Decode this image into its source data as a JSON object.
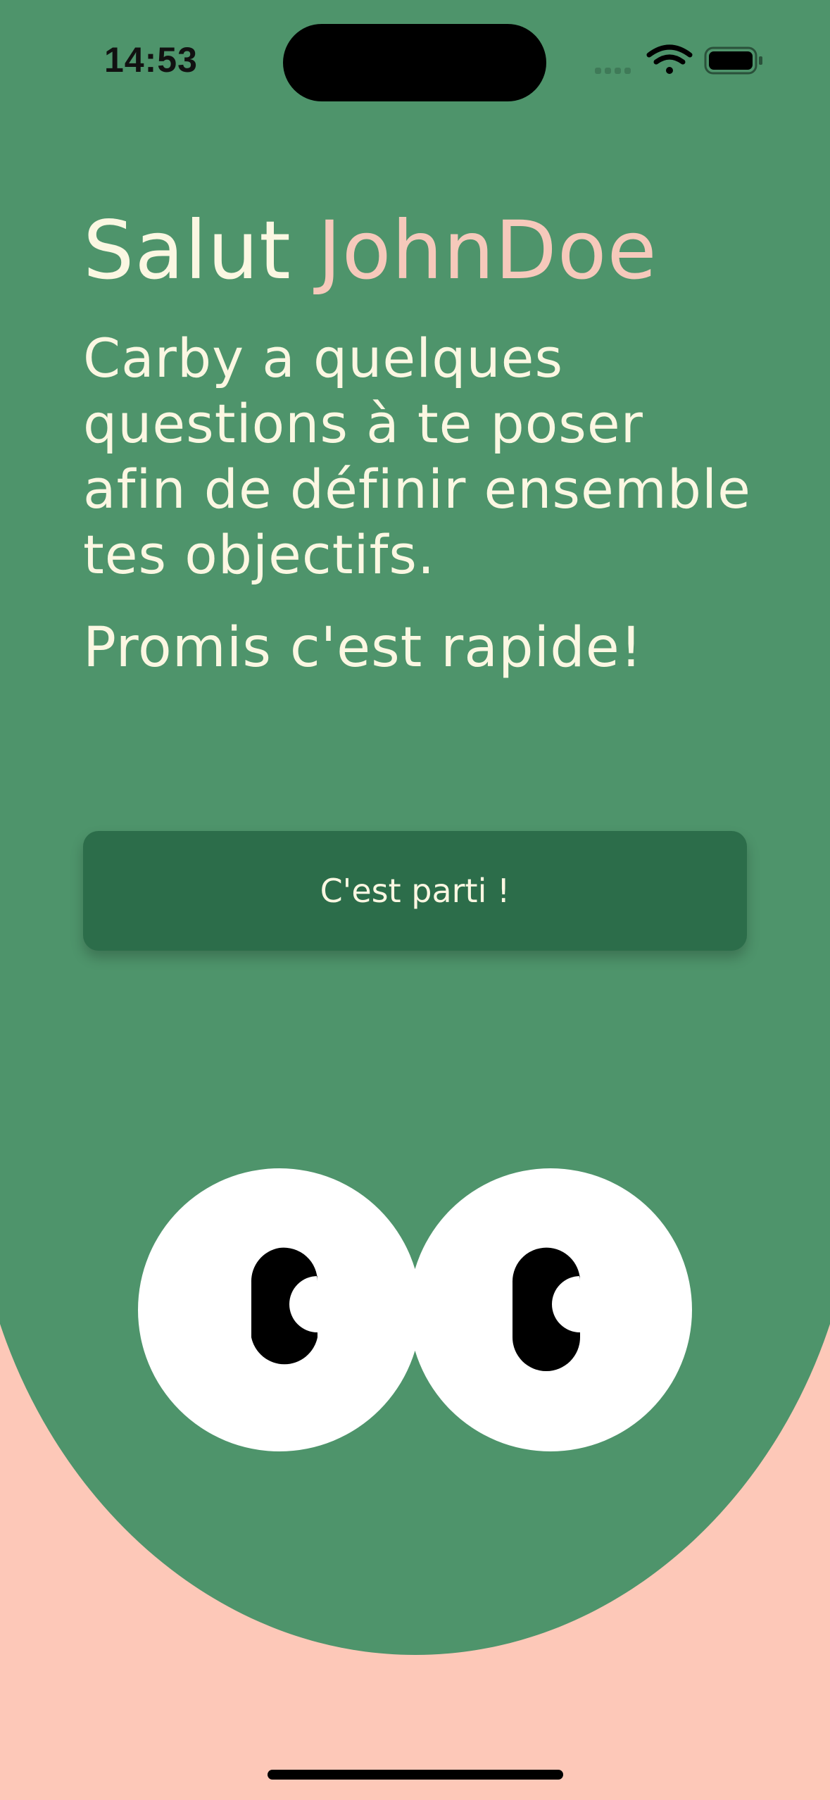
{
  "status_bar": {
    "time": "14:53"
  },
  "greeting": {
    "prefix": "Salut ",
    "username": "JohnDoe"
  },
  "intro_text": "Carby a quelques questions à te poser afin de définir ensemble tes objectifs.",
  "promise_text": "Promis c'est rapide!",
  "start_button_label": "C'est parti !",
  "colors": {
    "primary_green": "#4e946b",
    "button_green": "#2c6d4a",
    "peach": "#fdc8b8",
    "cream_text": "#fbf7e2",
    "name_accent": "#f6c9bb"
  },
  "icons": {
    "signal": "cellular-signal-icon",
    "wifi": "wifi-icon",
    "battery": "battery-icon"
  }
}
